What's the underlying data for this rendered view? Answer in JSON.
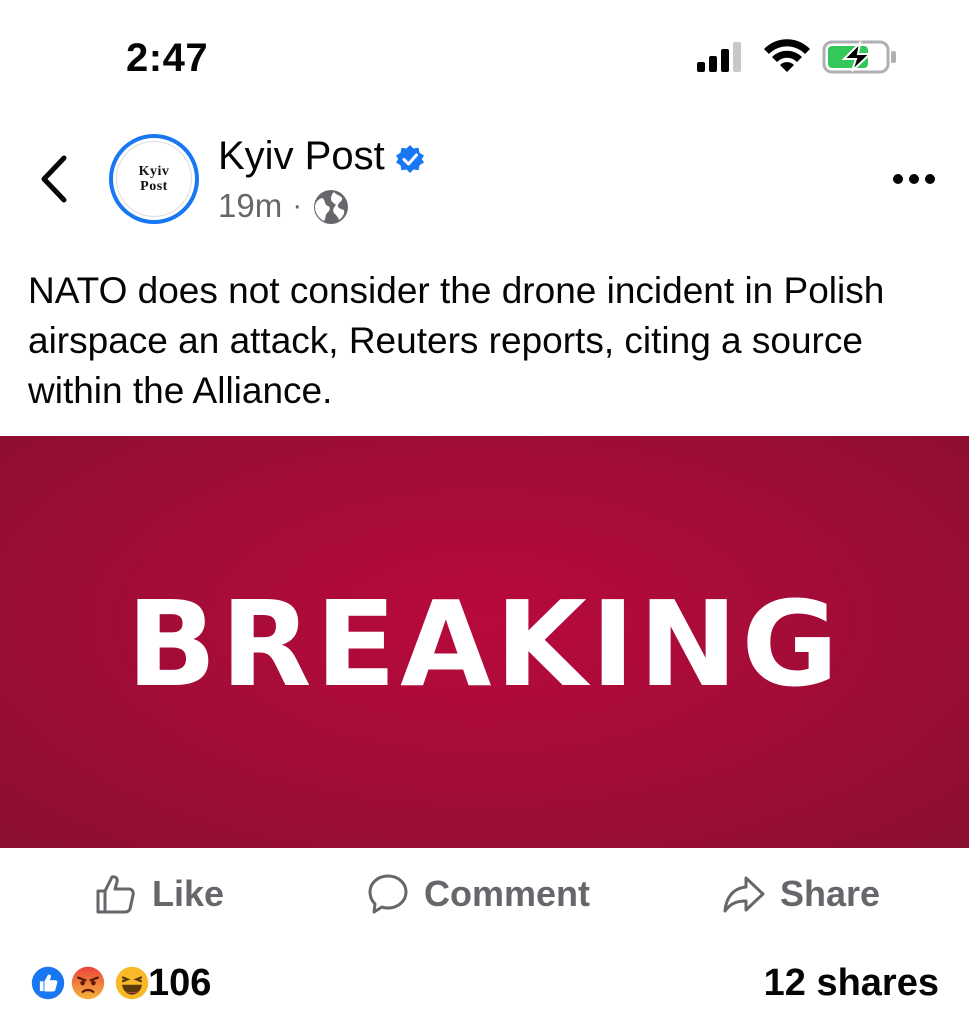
{
  "status_bar": {
    "time": "2:47"
  },
  "post": {
    "page_name": "Kyiv Post",
    "avatar_text": [
      "Kyiv",
      "Post"
    ],
    "timestamp": "19m",
    "meta_separator": "·",
    "text": "NATO does not consider the drone incident in Polish airspace an attack, Reuters reports, citing a source within the Alliance.",
    "image_text": "BREAKING",
    "image_color": "#a50c38"
  },
  "actions": {
    "like": "Like",
    "comment": "Comment",
    "share": "Share"
  },
  "footer": {
    "reaction_count": "106",
    "reactions": [
      "like-reaction-icon",
      "angry-reaction-icon",
      "haha-reaction-icon"
    ],
    "shares": "12 shares"
  },
  "colors": {
    "accent": "#1877f2",
    "secondary_text": "#65676b",
    "battery_green": "#34c759"
  }
}
